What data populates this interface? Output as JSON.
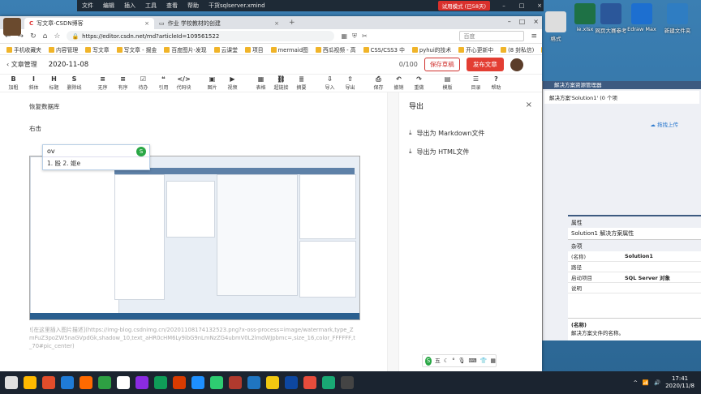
{
  "xmind": {
    "menu": [
      "文件",
      "编辑",
      "插入",
      "工具",
      "查看",
      "帮助"
    ],
    "doc_title": "干货sqlserver.xmind",
    "trial": "试用模式 (已58天)"
  },
  "desktop_icons": [
    {
      "label": "格式",
      "color": "#555"
    },
    {
      "label": "ie.xlsx",
      "color": "#1e7145"
    },
    {
      "label": "网页大赛参考",
      "color": "#2b579a"
    },
    {
      "label": "Edraw Max",
      "color": "#1d6fd0"
    },
    {
      "label": "新建文件夹",
      "color": "#2f7dc2"
    }
  ],
  "browser": {
    "tabs": [
      {
        "label": "写文章-CSDN博客",
        "active": true
      },
      {
        "label": "作业 学校教材的创建",
        "active": false
      }
    ],
    "url": "https://editor.csdn.net/md?articleId=109561522",
    "search_placeholder": "百度",
    "bookmarks": [
      "手机收藏夹",
      "内容管理",
      "写文章",
      "写文章 - 掘金",
      "百度图片-发现",
      "云课堂",
      "项目",
      "mermaid图",
      "西瓜视频 - 高",
      "CSS/CSS3 中",
      "pyhui的技术",
      "开心更新中",
      "(8 封私信)",
      "临时"
    ]
  },
  "editor": {
    "back_label": "文章管理",
    "title_value": "2020-11-08",
    "count": "0/100",
    "save_draft": "保存草稿",
    "publish": "发布文章",
    "toolbar": [
      {
        "icon": "B",
        "label": "加粗"
      },
      {
        "icon": "I",
        "label": "斜体"
      },
      {
        "icon": "H",
        "label": "标题"
      },
      {
        "icon": "S",
        "label": "删除线"
      },
      {
        "icon": "≡",
        "label": "无序"
      },
      {
        "icon": "≡",
        "label": "有序"
      },
      {
        "icon": "☑",
        "label": "待办"
      },
      {
        "icon": "❝",
        "label": "引用"
      },
      {
        "icon": "</>",
        "label": "代码块"
      },
      {
        "icon": "▣",
        "label": "图片"
      },
      {
        "icon": "▶",
        "label": "视频"
      },
      {
        "icon": "▦",
        "label": "表格"
      },
      {
        "icon": "⛓",
        "label": "超链接"
      },
      {
        "icon": "≣",
        "label": "摘要"
      },
      {
        "icon": "⇩",
        "label": "导入"
      },
      {
        "icon": "⇧",
        "label": "导出"
      },
      {
        "icon": "⎙",
        "label": "保存"
      },
      {
        "icon": "↶",
        "label": "撤销"
      },
      {
        "icon": "↷",
        "label": "重做"
      },
      {
        "icon": "▤",
        "label": "模版"
      },
      {
        "icon": "☰",
        "label": "目录"
      },
      {
        "icon": "?",
        "label": "帮助"
      }
    ],
    "lines": [
      "恢复数据库",
      "右击"
    ],
    "ime_typed": "ov",
    "ime_candidates": "1. 殴  2. 妪e",
    "image_alt": "![在这里插入图片描述](https://img-blog.csdnimg.cn/20201108174132523.png?x-oss-process=image/watermark,type_ZmFuZ3poZW5naGVpdGk,shadow_10,text_aHR0cHM6Ly9ibG9nLmNzZG4ubmV0L2lmdWJpbmc=,size_16,color_FFFFFF,t_70#pic_center)",
    "export_title": "导出",
    "export_items": [
      "导出为 Markdown文件",
      "导出为 HTML文件"
    ]
  },
  "vs": {
    "panel_title": "解决方案资源管理器",
    "solution_line": "解决方案'Solution1' (0 个项",
    "upload": "拖拽上传",
    "props_title": "属性",
    "props_subject": "Solution1 解决方案属性",
    "props_group": "杂项",
    "props": [
      {
        "k": "(名称)",
        "v": "Solution1"
      },
      {
        "k": "路径",
        "v": ""
      },
      {
        "k": "启动项目",
        "v": "SQL Server 对象"
      },
      {
        "k": "说明",
        "v": ""
      }
    ],
    "desc_title": "(名称)",
    "desc_text": "解决方案文件的名称。"
  },
  "taskbar": {
    "time": "17:41",
    "date": "2020/11/8",
    "colors": [
      "#e0e0e0",
      "#ffb900",
      "#e24d2b",
      "#1f7bd6",
      "#ff6a00",
      "#2ea043",
      "#ffffff",
      "#8a2be2",
      "#0f9d58",
      "#d83b01",
      "#1e90ff",
      "#2ecc71",
      "#b03a2e",
      "#1f75c1",
      "#f2c811",
      "#0d47a1",
      "#e74c3c",
      "#19a974",
      "#444"
    ]
  }
}
